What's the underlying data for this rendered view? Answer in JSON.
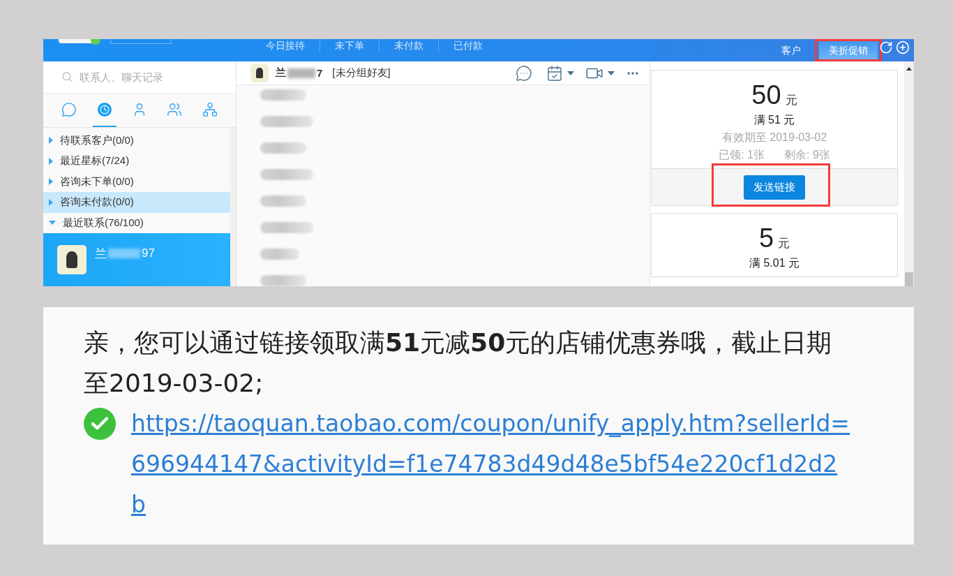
{
  "top_bar": {
    "nav": [
      "今日接待",
      "未下单",
      "未付款",
      "已付款"
    ],
    "tabs": [
      {
        "label": "客户",
        "selected": false,
        "highlighted": false
      },
      {
        "label": "美折促销",
        "selected": true,
        "highlighted": true
      }
    ]
  },
  "sidebar": {
    "search": {
      "placeholder": "联系人、聊天记录"
    },
    "icon_tabs": [
      {
        "kind": "chat",
        "selected": false
      },
      {
        "kind": "recent",
        "selected": true
      },
      {
        "kind": "contact",
        "selected": false
      },
      {
        "kind": "group",
        "selected": false
      },
      {
        "kind": "org",
        "selected": false
      }
    ],
    "groups": [
      {
        "label": "待联系客户(0/0)",
        "expanded": false,
        "selected": false
      },
      {
        "label": "最近星标(7/24)",
        "expanded": false,
        "selected": false
      },
      {
        "label": "咨询未下单(0/0)",
        "expanded": false,
        "selected": false
      },
      {
        "label": "咨询未付款(0/0)",
        "expanded": false,
        "selected": true
      },
      {
        "label": "最近联系(76/100)",
        "expanded": true,
        "selected": false,
        "children": [
          {
            "name_start": "兰",
            "name_end": "97",
            "selected": true
          }
        ]
      }
    ]
  },
  "chat": {
    "contact": {
      "name_start": "兰",
      "name_end": "7",
      "tag": "[未分组好友]"
    }
  },
  "coupons": [
    {
      "amount": "50",
      "unit": "元",
      "condition": "满 51 元",
      "expiry": "有效期至 2019-03-02",
      "claimed": "已领: 1张",
      "remaining": "剩余: 9张",
      "button": "发送链接",
      "highlighted": true
    },
    {
      "amount": "5",
      "unit": "元",
      "condition": "满 5.01 元"
    }
  ],
  "message": {
    "text": "亲，您可以通过链接领取满**51**元减**50**元的店铺优惠券哦，截止日期至2019-03-02;",
    "verified": true,
    "link": "https://taoquan.taobao.com/coupon/unify_apply.htm?sellerId=696944147&activityId=f1e74783d49d48e5bf54e220cf1d2d2b"
  }
}
